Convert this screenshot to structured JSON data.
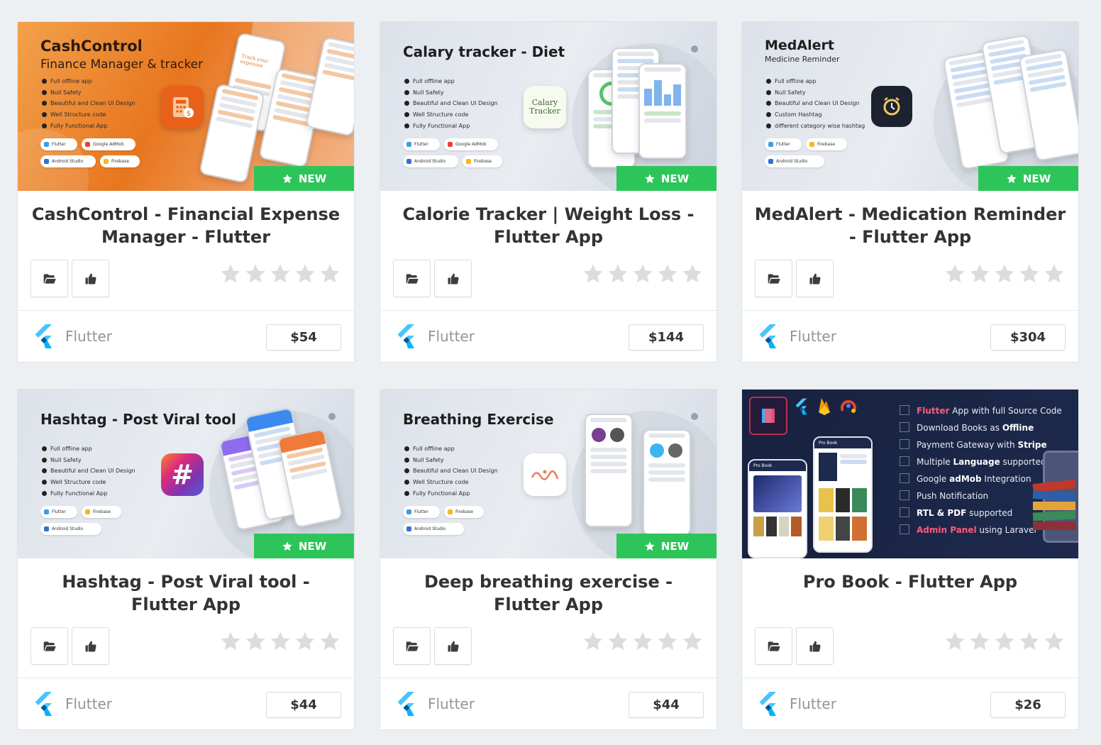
{
  "badge_label": "NEW",
  "platform_label": "Flutter",
  "colors": {
    "badge": "#2dc55a",
    "title": "#333333",
    "platform": "#8e969d",
    "star_empty": "#dcdcdc",
    "page_bg": "#edf0f3"
  },
  "icons": {
    "folder": "folder-open-icon",
    "like": "thumbs-up-icon",
    "star": "star-icon",
    "platform": "flutter-logo-icon"
  },
  "products": [
    {
      "title": "CashControl - Financial Expense Manager - Flutter",
      "price": "$54",
      "rating": 0,
      "is_new": true,
      "thumb": {
        "title": "CashControl",
        "subtitle": "Finance Manager & tracker",
        "features": [
          "Full offline app",
          "Null Safety",
          "Beautiful and Clean UI Design",
          "Well Structure code",
          "Fully Functional App"
        ],
        "tags": [
          "Flutter",
          "Google AdMob",
          "Android Studio",
          "Firebase"
        ],
        "phone_text": "Track your expenses"
      }
    },
    {
      "title": "Calorie Tracker | Weight Loss - Flutter App",
      "price": "$144",
      "rating": 0,
      "is_new": true,
      "thumb": {
        "title": "Calary tracker - Diet",
        "features": [
          "Full offline app",
          "Null Safety",
          "Beautiful and Clean UI Design",
          "Well Structure code",
          "Fully Functional App"
        ],
        "tags": [
          "Flutter",
          "Google AdMob",
          "Android Studio",
          "Firebase"
        ],
        "icon_text": "Calary Tracker"
      }
    },
    {
      "title": "MedAlert - Medication Reminder - Flutter App",
      "price": "$304",
      "rating": 0,
      "is_new": true,
      "thumb": {
        "title": "MedAlert",
        "subtitle": "Medicine Reminder",
        "features": [
          "Full offline app",
          "Null Safety",
          "Beautiful and Clean UI Design",
          "Custom Hashtag",
          "different category wise hashtag"
        ],
        "tags": [
          "Flutter",
          "Firebase",
          "Android Studio"
        ]
      }
    },
    {
      "title": "Hashtag - Post Viral tool - Flutter App",
      "price": "$44",
      "rating": 0,
      "is_new": true,
      "thumb": {
        "title": "Hashtag - Post Viral tool",
        "features": [
          "Full offline app",
          "Null Safety",
          "Beautiful and Clean UI Design",
          "Well Structure code",
          "Fully Functional App"
        ],
        "tags": [
          "Flutter",
          "Firebase",
          "Android Studio"
        ],
        "icon_text": "#"
      }
    },
    {
      "title": "Deep breathing exercise - Flutter App",
      "price": "$44",
      "rating": 0,
      "is_new": true,
      "thumb": {
        "title": "Breathing Exercise",
        "features": [
          "Full offline app",
          "Null Safety",
          "Beautiful and Clean UI Design",
          "Well Structure code",
          "Fully Functional App"
        ],
        "tags": [
          "Flutter",
          "Firebase",
          "Android Studio"
        ]
      }
    },
    {
      "title": "Pro Book - Flutter App",
      "price": "$26",
      "rating": 0,
      "is_new": false,
      "thumb": {
        "lines": [
          {
            "pre": "",
            "hl": "Flutter",
            "post": " App with full Source Code"
          },
          {
            "pre": "Download Books as ",
            "b": "Offline",
            "post": ""
          },
          {
            "pre": "Payment Gateway with ",
            "b": "Stripe",
            "post": ""
          },
          {
            "pre": "Multiple ",
            "b": "Language",
            "post": " supported"
          },
          {
            "pre": "Google ",
            "b": "adMob",
            "post": " Integration"
          },
          {
            "pre": "Push Notification",
            "b": "",
            "post": ""
          },
          {
            "pre": "",
            "b": "RTL & PDF",
            "post": " supported"
          },
          {
            "pre": "",
            "hl": "Admin Panel",
            "post": " using Laravel"
          }
        ],
        "phone_title": "Pro Book"
      }
    }
  ]
}
